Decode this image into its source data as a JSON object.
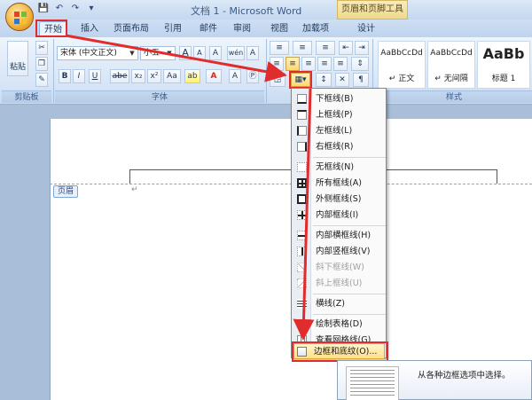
{
  "window": {
    "title": "文档 1 - Microsoft Word",
    "context_tab_group": "页眉和页脚工具"
  },
  "tabs": [
    {
      "label": "开始"
    },
    {
      "label": "插入"
    },
    {
      "label": "页面布局"
    },
    {
      "label": "引用"
    },
    {
      "label": "邮件"
    },
    {
      "label": "审阅"
    },
    {
      "label": "视图"
    },
    {
      "label": "加载项"
    },
    {
      "label": "设计"
    }
  ],
  "ribbon": {
    "clipboard": {
      "paste_label": "粘贴",
      "group_label": "剪贴板"
    },
    "font": {
      "font_name": "宋体 (中文正文)",
      "font_size": "小五",
      "group_label": "字体",
      "bold": "B",
      "italic": "I",
      "underline": "U",
      "strike": "abe",
      "subscript": "x₂",
      "superscript": "x²",
      "change_case": "Aa",
      "grow": "A",
      "shrink": "A",
      "clear": "A",
      "wen": "wén",
      "char_border": "A"
    },
    "styles": {
      "group_label": "样式",
      "items": [
        {
          "sample": "AaBbCcDd",
          "name": "↵ 正文"
        },
        {
          "sample": "AaBbCcDd",
          "name": "↵ 无间隔"
        },
        {
          "sample": "AaBb",
          "name": "标题 1"
        }
      ]
    }
  },
  "document": {
    "header_tag": "页眉",
    "para_mark": "↵"
  },
  "border_menu": {
    "items": [
      {
        "label": "下框线(B)",
        "enabled": true
      },
      {
        "label": "上框线(P)",
        "enabled": true
      },
      {
        "label": "左框线(L)",
        "enabled": true
      },
      {
        "label": "右框线(R)",
        "enabled": true
      },
      {
        "label": "无框线(N)",
        "enabled": true
      },
      {
        "label": "所有框线(A)",
        "enabled": true
      },
      {
        "label": "外侧框线(S)",
        "enabled": true
      },
      {
        "label": "内部框线(I)",
        "enabled": true
      },
      {
        "label": "内部横框线(H)",
        "enabled": true
      },
      {
        "label": "内部竖框线(V)",
        "enabled": true
      },
      {
        "label": "斜下框线(W)",
        "enabled": false
      },
      {
        "label": "斜上框线(U)",
        "enabled": false
      },
      {
        "label": "横线(Z)",
        "enabled": true
      },
      {
        "label": "绘制表格(D)",
        "enabled": true
      },
      {
        "label": "查看网格线(G)",
        "enabled": true
      },
      {
        "label": "边框和底纹(O)...",
        "enabled": true,
        "highlighted": true
      }
    ]
  },
  "tooltip": {
    "text": "从各种边框选项中选择。"
  },
  "colors": {
    "annotation_red": "#e02c2c",
    "ribbon_blue": "#d7e5f6",
    "highlight_yellow": "#ffe08a"
  }
}
